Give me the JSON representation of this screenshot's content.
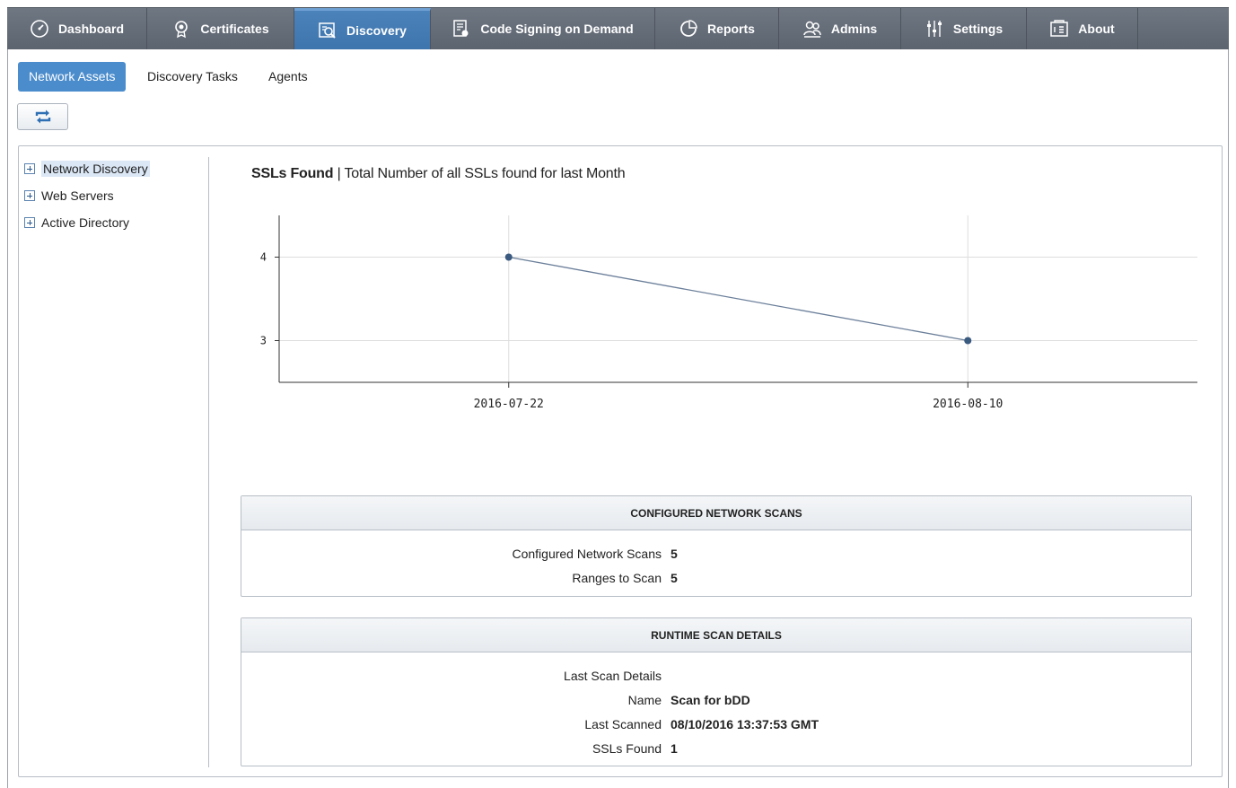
{
  "nav": {
    "tabs": [
      {
        "label": "Dashboard",
        "icon": "gauge-icon"
      },
      {
        "label": "Certificates",
        "icon": "certificate-icon"
      },
      {
        "label": "Discovery",
        "icon": "discovery-icon",
        "active": true
      },
      {
        "label": "Code Signing on Demand",
        "icon": "code-signing-icon"
      },
      {
        "label": "Reports",
        "icon": "reports-icon"
      },
      {
        "label": "Admins",
        "icon": "admins-icon"
      },
      {
        "label": "Settings",
        "icon": "sliders-icon"
      },
      {
        "label": "About",
        "icon": "about-icon"
      }
    ]
  },
  "subtabs": {
    "network_assets": "Network Assets",
    "discovery_tasks": "Discovery Tasks",
    "agents": "Agents"
  },
  "toolbar": {
    "refresh_icon": "refresh-icon"
  },
  "tree": {
    "items": [
      "Network Discovery",
      "Web Servers",
      "Active Directory"
    ]
  },
  "chart": {
    "title_bold": "SSLs Found",
    "title_rest": " | Total Number of all SSLs found for last Month"
  },
  "chart_data": {
    "type": "line",
    "x": [
      "2016-07-22",
      "2016-08-10"
    ],
    "series": [
      {
        "values": [
          4,
          3
        ]
      }
    ],
    "yticks": [
      3,
      4
    ],
    "ylim": [
      2.5,
      4.5
    ],
    "xlabel": "",
    "ylabel": "",
    "grid": true,
    "line_color": "#6b7f9a",
    "point_color": "#3b5a80"
  },
  "configured": {
    "title": "CONFIGURED NETWORK SCANS",
    "rows": [
      {
        "label": "Configured Network Scans",
        "value": "5"
      },
      {
        "label": "Ranges to Scan",
        "value": "5"
      }
    ]
  },
  "runtime": {
    "title": "RUNTIME SCAN DETAILS",
    "rows": [
      {
        "label": "Last Scan Details",
        "value": ""
      },
      {
        "label": "Name",
        "value": "Scan for bDD"
      },
      {
        "label": "Last Scanned",
        "value": "08/10/2016 13:37:53 GMT"
      },
      {
        "label": "SSLs Found",
        "value": "1"
      }
    ]
  },
  "colors": {
    "nav_bg": "#636b76",
    "nav_active": "#4580b8",
    "subtab_active": "#4a8ccc"
  }
}
